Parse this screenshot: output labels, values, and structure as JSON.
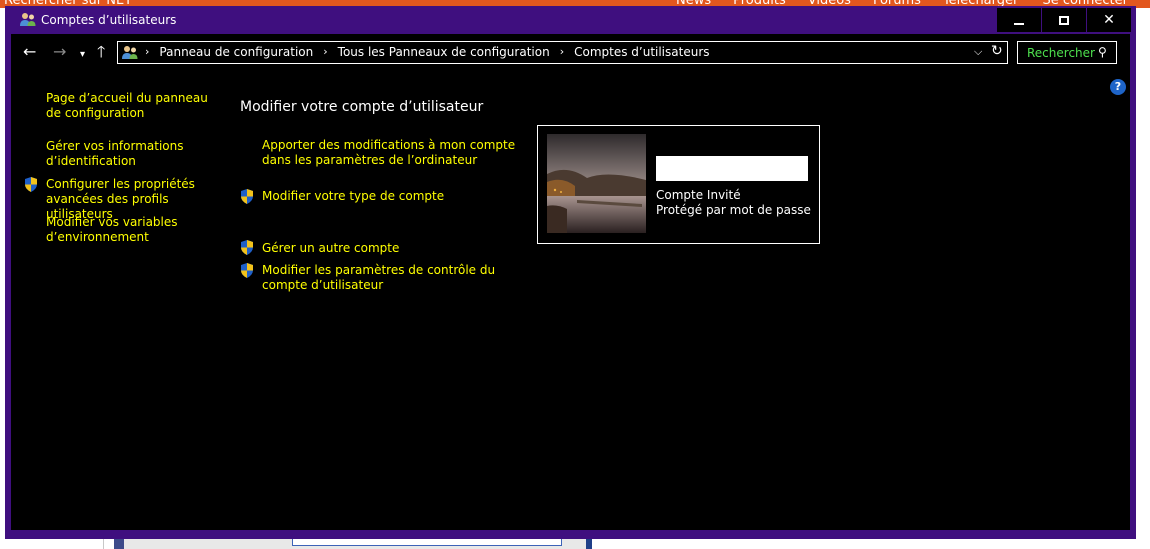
{
  "background_site": {
    "search_label": "Rechercher sur  NET",
    "nav": [
      "News",
      "Produits",
      "Vidéos",
      "Forums",
      "Télécharger"
    ],
    "login": "Se connecter"
  },
  "window": {
    "title": "Comptes d’utilisateurs"
  },
  "breadcrumb": [
    "Panneau de configuration",
    "Tous les Panneaux de configuration",
    "Comptes d’utilisateurs"
  ],
  "search": {
    "placeholder": "Rechercher"
  },
  "help_label": "?",
  "left_pane": {
    "home_link": "Page d’accueil du panneau de configuration",
    "links": [
      "Gérer vos informations d’identification",
      "Configurer les propriétés avancées des profils utilisateurs",
      "Modifier vos variables d’environnement"
    ]
  },
  "main": {
    "title": "Modifier votre compte d’utilisateur",
    "links": [
      "Apporter des modifications à mon compte dans les paramètres de l’ordinateur",
      "Modifier votre type de compte",
      "Gérer un autre compte",
      "Modifier les paramètres de contrôle du compte d’utilisateur"
    ]
  },
  "account": {
    "name": "",
    "type": "Compte Invité",
    "password_status": "Protégé par mot de passe"
  },
  "colors": {
    "window_frame": "#3f0f7f",
    "link": "#ffff00",
    "search_text": "#4ee04e",
    "background": "#000000"
  }
}
